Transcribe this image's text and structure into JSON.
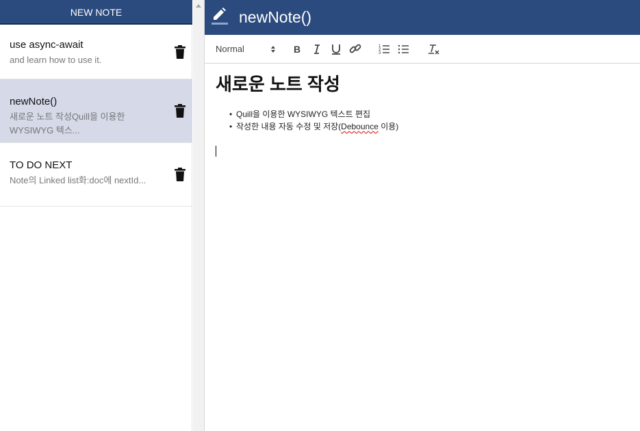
{
  "sidebar": {
    "new_note_label": "NEW NOTE",
    "notes": [
      {
        "title": "use async-await",
        "preview": "and learn how to use it."
      },
      {
        "title": "newNote()",
        "preview": "새로운 노트 작성Quill을 이용한 WYSIWYG 텍스..."
      },
      {
        "title": "TO DO NEXT",
        "preview": "Note의 Linked list화:doc에 nextId..."
      }
    ]
  },
  "editor": {
    "title": "newNote()",
    "toolbar": {
      "format": "Normal"
    },
    "heading": "새로운 노트 작성",
    "bullets": [
      {
        "text": "Quill을 이용한 WYSIWYG 텍스트 편집"
      },
      {
        "pre": "작성한 내용 자동 수정 및 저장(",
        "underlined": "Debounce",
        "post": " 이용)"
      }
    ]
  },
  "colors": {
    "header_bg": "#2b4a7e",
    "active_note_bg": "#d5d9e8"
  }
}
